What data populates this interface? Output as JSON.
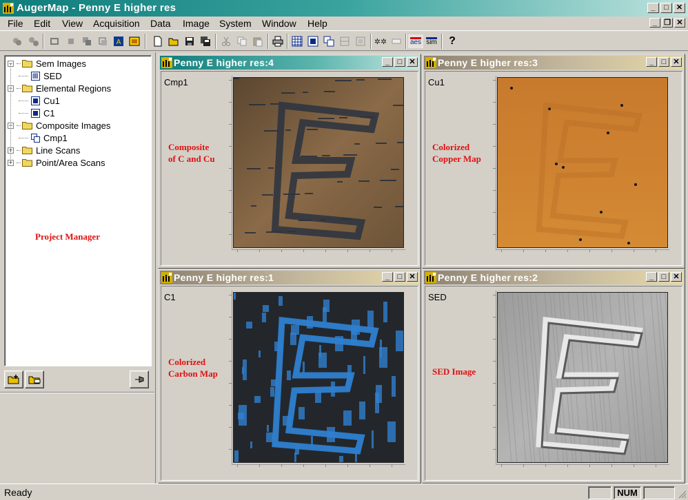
{
  "app": {
    "title": "AugerMap - Penny E higher res",
    "colors": {
      "active_caption": "#0e7c7b",
      "annotation": "#e01010",
      "face": "#d4d0c8"
    }
  },
  "menu": [
    "File",
    "Edit",
    "View",
    "Acquisition",
    "Data",
    "Image",
    "System",
    "Window",
    "Help"
  ],
  "toolbar": {
    "aes_label": "aes",
    "sim_label": "sim",
    "help_label": "?"
  },
  "project_manager": {
    "label": "Project Manager",
    "tree": [
      {
        "label": "Sem Images",
        "level": 0,
        "expander": "−",
        "kind": "folder"
      },
      {
        "label": "SED",
        "level": 1,
        "kind": "image"
      },
      {
        "label": "Elemental Regions",
        "level": 0,
        "expander": "−",
        "kind": "folder"
      },
      {
        "label": "Cu1",
        "level": 1,
        "kind": "region"
      },
      {
        "label": "C1",
        "level": 1,
        "kind": "region"
      },
      {
        "label": "Composite Images",
        "level": 0,
        "expander": "−",
        "kind": "folder"
      },
      {
        "label": "Cmp1",
        "level": 1,
        "kind": "composite"
      },
      {
        "label": "Line Scans",
        "level": 0,
        "expander": "+",
        "kind": "folder"
      },
      {
        "label": "Point/Area Scans",
        "level": 0,
        "expander": "+",
        "kind": "folder"
      }
    ]
  },
  "windows": [
    {
      "title": "Penny E higher res:4",
      "image_name": "Cmp1",
      "annotation": [
        "Composite",
        "of C and Cu"
      ],
      "active": true,
      "style": "composite"
    },
    {
      "title": "Penny E higher res:3",
      "image_name": "Cu1",
      "annotation": [
        "Colorized",
        "Copper Map"
      ],
      "active": false,
      "style": "copper"
    },
    {
      "title": "Penny E higher res:1",
      "image_name": "C1",
      "annotation": [
        "Colorized",
        "Carbon Map"
      ],
      "active": false,
      "style": "carbon"
    },
    {
      "title": "Penny E higher res:2",
      "image_name": "SED",
      "annotation": [
        "SED Image"
      ],
      "active": false,
      "style": "sed"
    }
  ],
  "status": {
    "message": "Ready",
    "num": "NUM"
  }
}
